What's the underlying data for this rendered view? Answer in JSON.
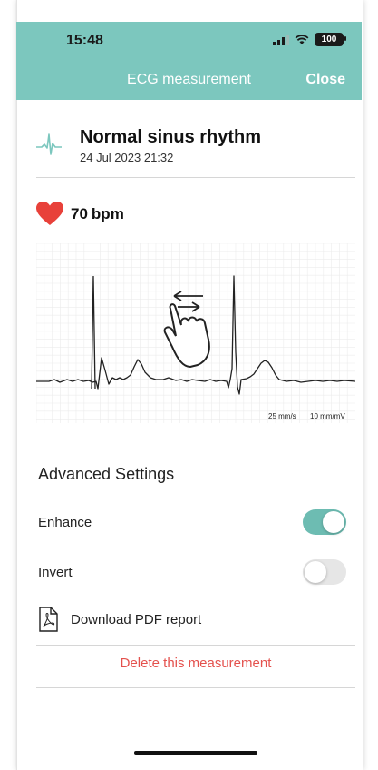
{
  "status_bar": {
    "time": "15:48",
    "battery": "100"
  },
  "nav": {
    "title": "ECG measurement",
    "close_label": "Close"
  },
  "measurement": {
    "result": "Normal sinus rhythm",
    "datetime": "24 Jul 2023 21:32"
  },
  "heart_rate": {
    "value": "70",
    "unit": "bpm"
  },
  "ecg_chart": {
    "speed_label": "25 mm/s",
    "gain_label": "10 mm/mV"
  },
  "settings": {
    "title": "Advanced Settings",
    "enhance_label": "Enhance",
    "enhance_on": true,
    "invert_label": "Invert",
    "invert_on": false
  },
  "actions": {
    "download_label": "Download PDF report",
    "delete_label": "Delete this measurement"
  },
  "colors": {
    "header": "#7cc7be",
    "toggle_on": "#6dbcb2",
    "toggle_off": "#e6e6e6",
    "heart": "#e8413a",
    "delete": "#e4514d"
  },
  "icons": [
    "ecg-waveform-icon",
    "heart-icon",
    "swipe-hand-icon",
    "pdf-file-icon",
    "wifi-icon",
    "signal-icon",
    "battery-icon"
  ]
}
